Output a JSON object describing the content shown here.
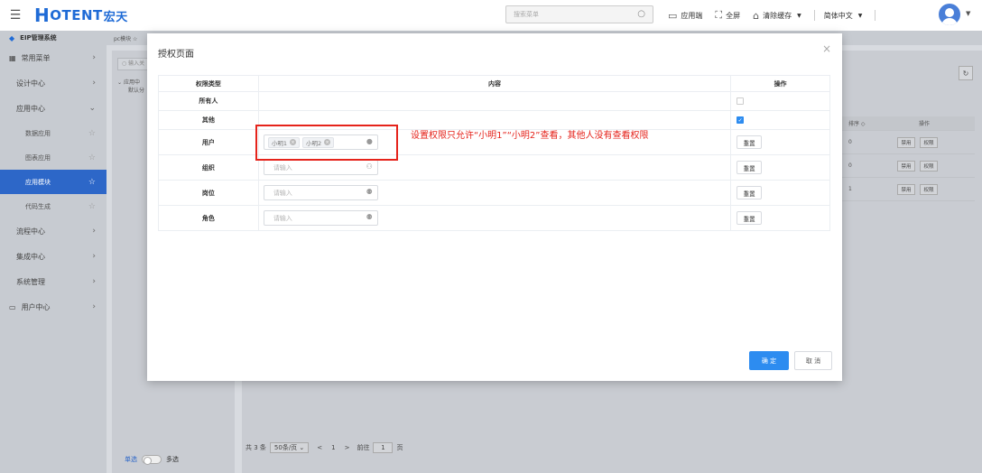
{
  "header": {
    "logo_mark": "H",
    "logo_text": "OTENT",
    "logo_cn": "宏天",
    "search_placeholder": "搜索菜单",
    "app_label": "应用端",
    "fullscreen_label": "全屏",
    "clear_cache_label": "清除缓存",
    "language_label": "简体中文"
  },
  "sidebar": {
    "system_title": "EIP管理系统",
    "items": [
      {
        "label": "常用菜单"
      },
      {
        "label": "设计中心"
      },
      {
        "label": "应用中心"
      },
      {
        "label": "流程中心"
      },
      {
        "label": "集成中心"
      },
      {
        "label": "系统管理"
      },
      {
        "label": "用户中心"
      }
    ],
    "sub_items": [
      {
        "label": "数据应用"
      },
      {
        "label": "图表应用"
      },
      {
        "label": "应用模块"
      },
      {
        "label": "代码生成"
      }
    ]
  },
  "background": {
    "tab_label": "pc模块",
    "tree_search": "输入关",
    "tree_lines": [
      "应用中",
      "默认分"
    ],
    "mode_single": "单选",
    "mode_multi": "多选",
    "table_col_a": "排序",
    "table_col_b": "操作",
    "rows": [
      {
        "sort": "0",
        "disable": "禁用",
        "perm": "权限"
      },
      {
        "sort": "0",
        "disable": "禁用",
        "perm": "权限"
      },
      {
        "sort": "1",
        "disable": "禁用",
        "perm": "权限"
      }
    ],
    "pager": {
      "total": "共 3 条",
      "page_size": "50条/页",
      "prev": "<",
      "page": "1",
      "next": ">",
      "goto_label": "前往",
      "goto_value": "1",
      "page_unit": "页"
    }
  },
  "modal": {
    "title": "授权页面",
    "columns": [
      "权限类型",
      "内容",
      "操作"
    ],
    "rows": [
      {
        "type": "所有人"
      },
      {
        "type": "其他"
      },
      {
        "type": "用户",
        "tags": [
          "小明1",
          "小明2"
        ],
        "reset": "重置"
      },
      {
        "type": "组织",
        "placeholder": "请输入",
        "reset": "重置"
      },
      {
        "type": "岗位",
        "placeholder": "请输入",
        "reset": "重置"
      },
      {
        "type": "角色",
        "placeholder": "请输入",
        "reset": "重置"
      }
    ],
    "annotation": "设置权限只允许“小明1”“小明2”查看，其他人没有查看权限",
    "confirm_label": "确 定",
    "cancel_label": "取 消"
  },
  "colors": {
    "primary": "#2d8cf0",
    "brand": "#1f6bd6",
    "annotation": "#e5231b"
  }
}
